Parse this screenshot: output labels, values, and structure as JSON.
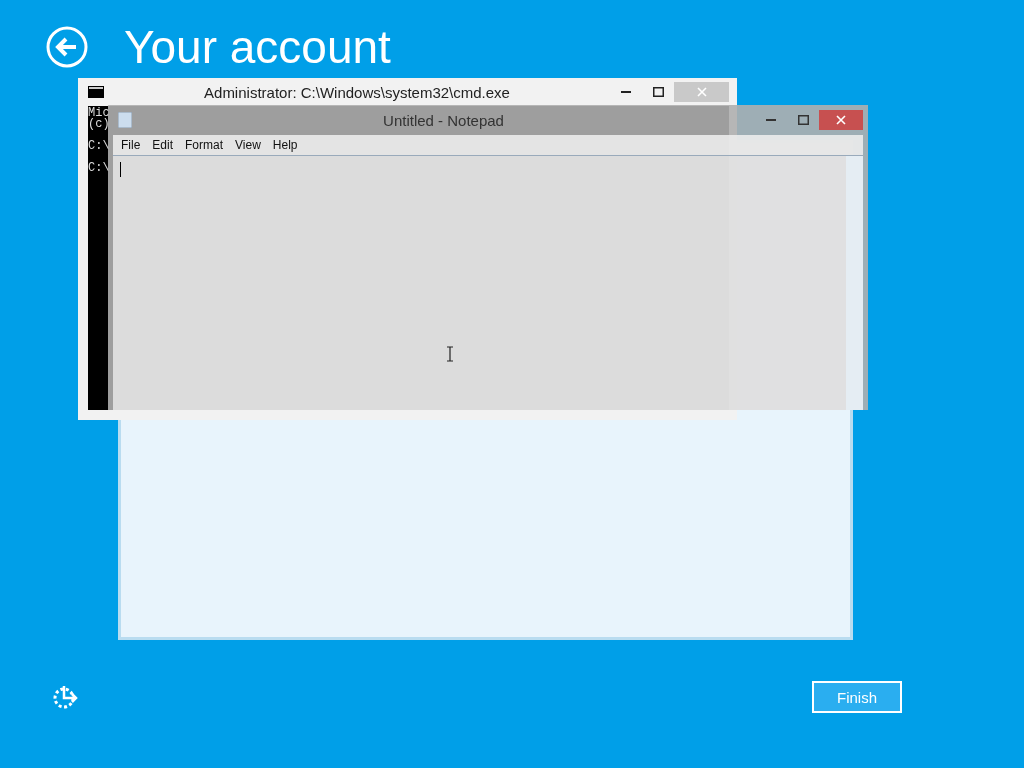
{
  "page": {
    "title": "Your account"
  },
  "cmd_window": {
    "title": "Administrator: C:\\Windows\\system32\\cmd.exe",
    "blocks": [
      [
        "Mic",
        "(c)"
      ],
      [
        "C:\\"
      ],
      [
        "C:\\"
      ]
    ]
  },
  "notepad_window": {
    "title": "Untitled - Notepad",
    "menu": [
      "File",
      "Edit",
      "Format",
      "View",
      "Help"
    ]
  },
  "finish_button": {
    "label": "Finish"
  }
}
